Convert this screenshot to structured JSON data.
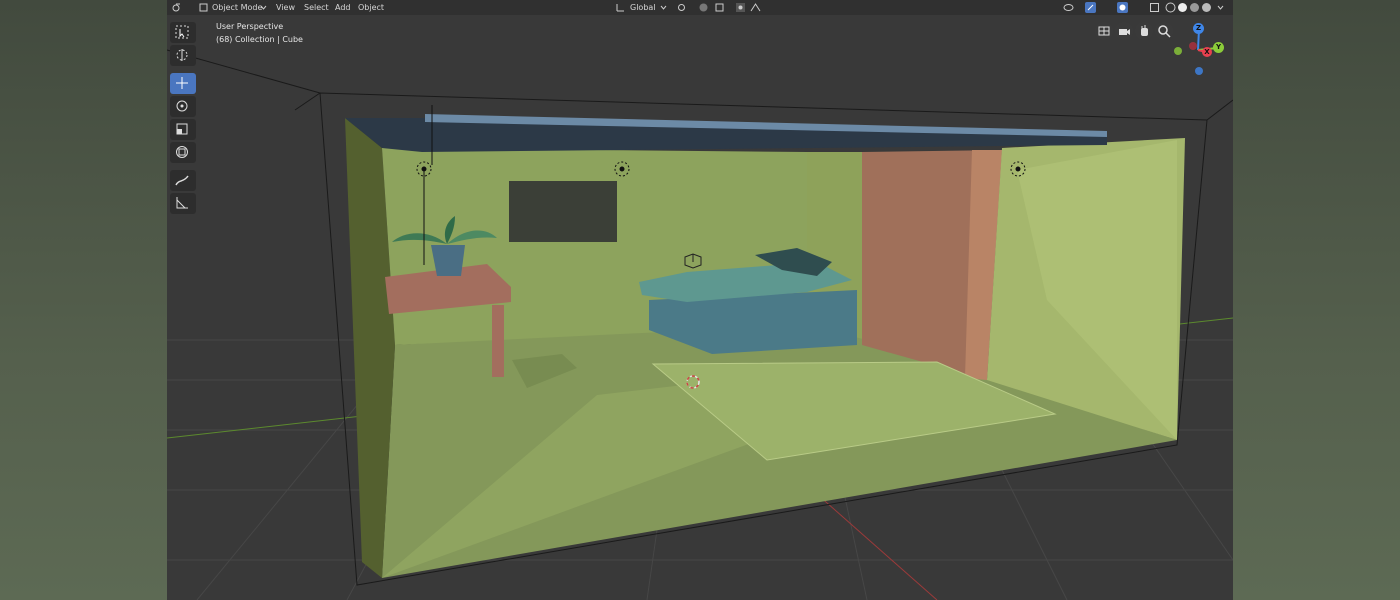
{
  "header": {
    "mode_label": "Object Mode",
    "menus": [
      "View",
      "Select",
      "Add",
      "Object"
    ],
    "transform_orientation": "Global"
  },
  "viewport": {
    "perspective_label": "User Perspective",
    "collection_label": "(68) Collection | Cube"
  },
  "gizmo": {
    "z_label": "Z",
    "y_label": "Y",
    "x_label": "X"
  },
  "icons": {
    "toolbar": [
      "select-box-icon",
      "cursor-icon",
      "move-icon",
      "rotate-icon",
      "scale-icon",
      "transform-icon",
      "annotate-icon",
      "measure-icon"
    ],
    "navigation": [
      "grid-view-icon",
      "camera-icon",
      "hand-pan-icon",
      "zoom-icon"
    ]
  },
  "colors": {
    "active_tool": "#4a76c0",
    "x_axis": "#e8404f",
    "y_axis": "#8ccc3a",
    "z_axis": "#3f86e8",
    "room_wall": "#8da35d"
  }
}
